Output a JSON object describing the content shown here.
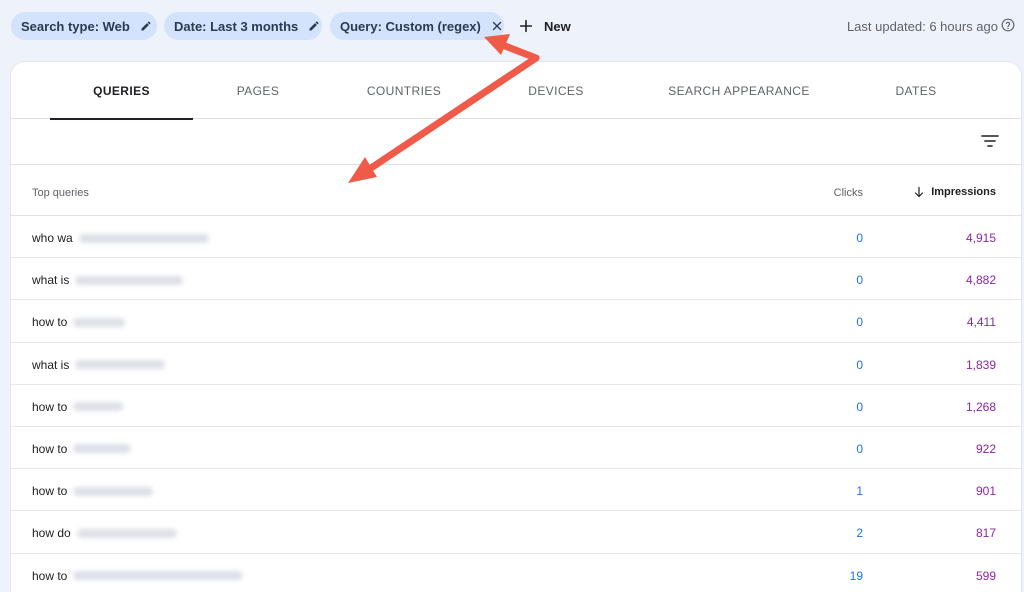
{
  "filters": {
    "chips": [
      {
        "label": "Search type: Web",
        "icon": "pencil-icon"
      },
      {
        "label": "Date: Last 3 months",
        "icon": "pencil-icon"
      },
      {
        "label": "Query: Custom (regex)",
        "icon": "close-icon"
      }
    ],
    "new_label": "New",
    "last_updated": "Last updated: 6 hours ago"
  },
  "tabs": [
    {
      "label": "QUERIES",
      "active": true
    },
    {
      "label": "PAGES",
      "active": false
    },
    {
      "label": "COUNTRIES",
      "active": false
    },
    {
      "label": "DEVICES",
      "active": false
    },
    {
      "label": "SEARCH APPEARANCE",
      "active": false
    },
    {
      "label": "DATES",
      "active": false
    }
  ],
  "table": {
    "headers": {
      "query": "Top queries",
      "clicks": "Clicks",
      "impressions": "Impressions"
    },
    "sort": "impressions-descending",
    "rows": [
      {
        "query": "who wa",
        "clicks": "0",
        "impressions": "4,915"
      },
      {
        "query": "what is",
        "clicks": "0",
        "impressions": "4,882"
      },
      {
        "query": "how to",
        "clicks": "0",
        "impressions": "4,411"
      },
      {
        "query": "what is",
        "clicks": "0",
        "impressions": "1,839"
      },
      {
        "query": "how to",
        "clicks": "0",
        "impressions": "1,268"
      },
      {
        "query": "how to",
        "clicks": "0",
        "impressions": "922"
      },
      {
        "query": "how to",
        "clicks": "1",
        "impressions": "901"
      },
      {
        "query": "how do",
        "clicks": "2",
        "impressions": "817"
      },
      {
        "query": "how to",
        "clicks": "19",
        "impressions": "599"
      }
    ]
  },
  "colors": {
    "chip_bg": "#d3e3fd",
    "clicks": "#1a73e8",
    "impressions": "#8e24aa",
    "annotation_arrow": "#f05a48"
  }
}
